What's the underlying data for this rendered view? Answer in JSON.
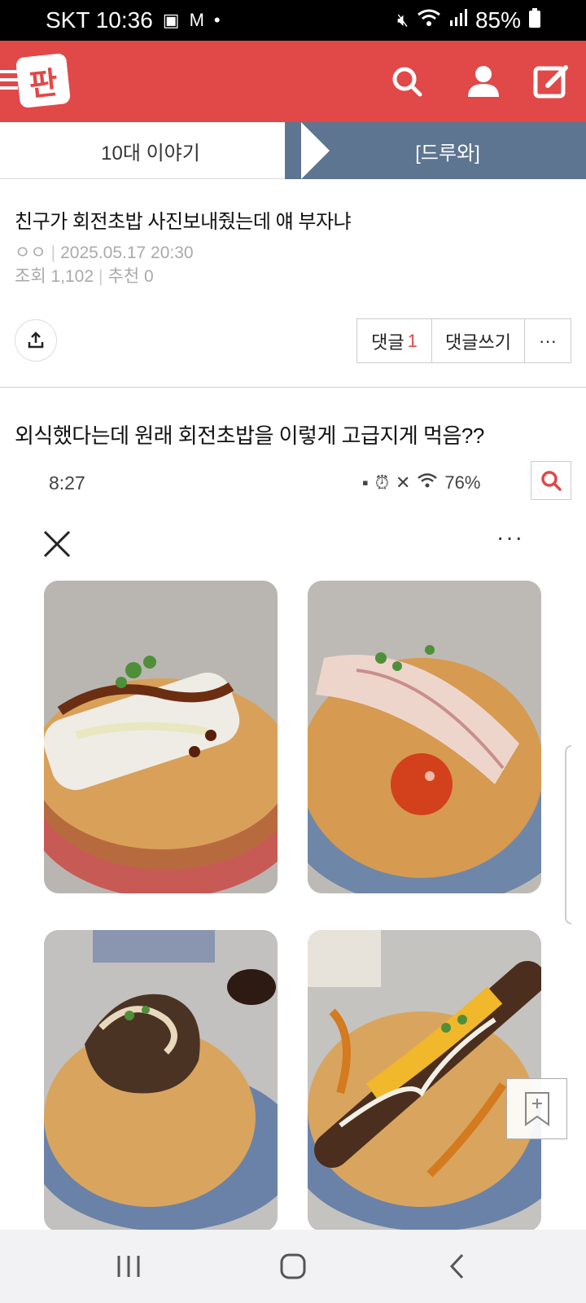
{
  "status_bar": {
    "carrier_time": "SKT 10:36",
    "battery": "85%",
    "icons": [
      "image-icon",
      "mail-icon",
      "dot-icon",
      "mute-icon",
      "wifi-icon",
      "signal-icon",
      "battery-icon"
    ]
  },
  "header": {
    "logo_text": "판",
    "icons": [
      "menu-icon",
      "search-icon",
      "user-icon",
      "write-icon"
    ],
    "colors": {
      "brand": "#e14848",
      "tab_active": "#5d7590"
    }
  },
  "tabs": {
    "left": "10대 이야기",
    "right": "[드루와]"
  },
  "post": {
    "title": "친구가 회전초밥 사진보내줬는데 얘 부자냐",
    "author": "ㅇㅇ",
    "date": "2025.05.17 20:30",
    "views_label": "조회",
    "views": "1,102",
    "recommend_label": "추천",
    "recommend": "0",
    "comment_label": "댓글",
    "comment_count": "1",
    "write_comment_label": "댓글쓰기",
    "more_label": "···",
    "body": "외식했다는데 원래 회전초밥을 이렇게 고급지게 먹음??"
  },
  "embedded_screenshot": {
    "time": "8:27",
    "battery": "76%",
    "more": "···"
  }
}
